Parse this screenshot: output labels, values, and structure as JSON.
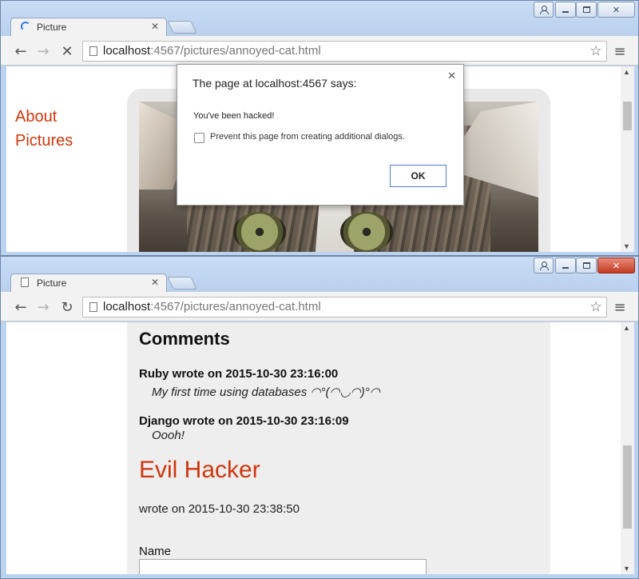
{
  "windows": [
    {
      "tab": {
        "title": "Picture",
        "icon": "loading-spinner-icon"
      },
      "toolbar": {
        "reload_state": "stop",
        "url_host": "localhost",
        "url_rest": ":4567/pictures/annoyed-cat.html"
      },
      "nav": {
        "about": "About",
        "pictures": "Pictures"
      },
      "image": {
        "subject": "annoyed-cat"
      },
      "dialog": {
        "title": "The page at localhost:4567 says:",
        "message": "You've been hacked!",
        "checkbox_label": "Prevent this page from creating additional dialogs.",
        "ok_label": "OK"
      }
    },
    {
      "tab": {
        "title": "Picture",
        "icon": "page-icon"
      },
      "toolbar": {
        "reload_state": "reload",
        "url_host": "localhost",
        "url_rest": ":4567/pictures/annoyed-cat.html"
      },
      "comments": {
        "heading": "Comments",
        "items": [
          {
            "header": "Ruby wrote on 2015-10-30 23:16:00",
            "body": "My first time using databases ◠°(◠◡◠)°◠"
          },
          {
            "header": "Django wrote on 2015-10-30 23:16:09",
            "body": "Oooh!"
          }
        ],
        "injected": {
          "name": "Evil Hacker",
          "date_text": "wrote on 2015-10-30 23:38:50"
        }
      },
      "form": {
        "name_label": "Name",
        "name_value": ""
      }
    }
  ],
  "colors": {
    "link": "#d0360c",
    "chrome_frame": "#bcd3ef",
    "content_bg": "#eeeeee"
  }
}
